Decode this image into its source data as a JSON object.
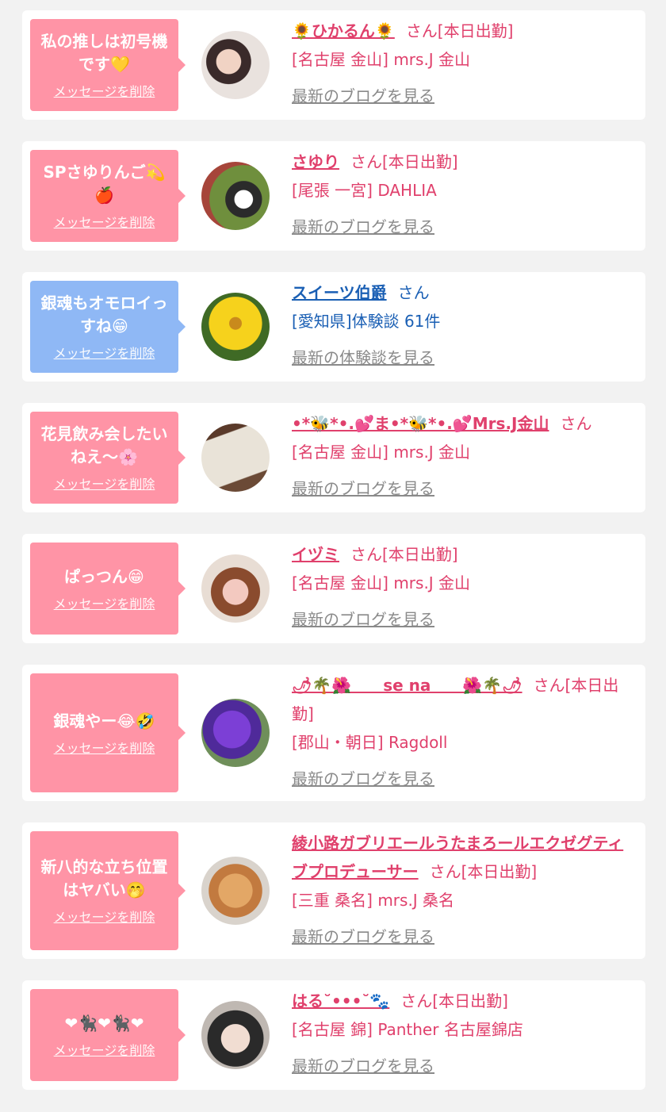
{
  "delete_label": "メッセージを削除",
  "cards": [
    {
      "message": "私の推しは初号機\nです💛",
      "name": "🌻ひかるん🌻",
      "suffix": "さん[本日出勤]",
      "shop": "[名古屋 金山] mrs.J 金山",
      "link": "最新のブログを見る",
      "theme": "pink"
    },
    {
      "message": "SPさゆりんご💫\n🍎",
      "name": "さゆり",
      "suffix": "さん[本日出勤]",
      "shop": "[尾張 一宮] DAHLIA",
      "link": "最新のブログを見る",
      "theme": "pink"
    },
    {
      "message": "銀魂もオモロイっ\nすね😁",
      "name": "スイーツ伯爵",
      "suffix": "さん",
      "shop": "[愛知県]体験談 61件",
      "link": "最新の体験談を見る",
      "theme": "blue"
    },
    {
      "message": "花見飲み会したい\nねえ〜🌸",
      "name": "•*🐝*•.💕ま•*🐝*•.💕Mrs.J金山",
      "suffix": "さん",
      "shop": "[名古屋 金山] mrs.J 金山",
      "link": "最新のブログを見る",
      "theme": "pink"
    },
    {
      "message": "ぱっつん😁",
      "name": "イヅミ",
      "suffix": "さん[本日出勤]",
      "shop": "[名古屋 金山] mrs.J 金山",
      "link": "最新のブログを見る",
      "theme": "pink"
    },
    {
      "message": "銀魂やー😂🤣",
      "name": "🌶🌴🌺　　se na　　🌺🌴🌶",
      "suffix": "さん[本日出勤]",
      "shop": "[郡山・朝日] Ragdoll",
      "link": "最新のブログを見る",
      "theme": "pink"
    },
    {
      "message": "新八的な立ち位置\nはヤバい🤭",
      "name": "綾小路ガブリエールうたまろールエクゼグティブプロデューサー",
      "suffix": "さん[本日出勤]",
      "shop": "[三重 桑名] mrs.J 桑名",
      "link": "最新のブログを見る",
      "theme": "pink"
    },
    {
      "message": "❤🐈‍⬛❤🐈‍⬛❤",
      "name": "はる˘•••˘🐾",
      "suffix": "さん[本日出勤]",
      "shop": "[名古屋 錦] Panther 名古屋錦店",
      "link": "最新のブログを見る",
      "theme": "pink"
    }
  ]
}
